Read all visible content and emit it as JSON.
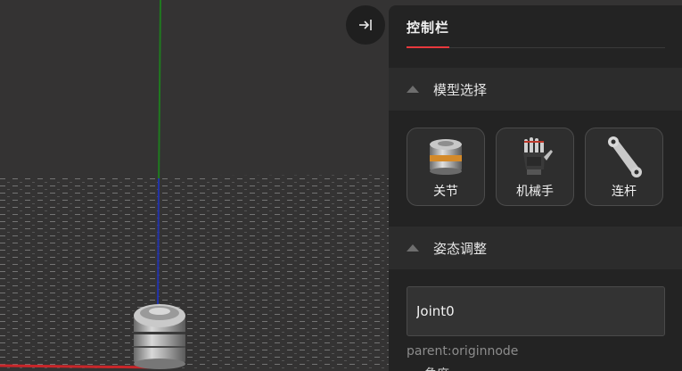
{
  "panel": {
    "title": "控制栏"
  },
  "sections": {
    "model": {
      "label": "模型选择",
      "cards": [
        {
          "label": "关节",
          "icon": "joint-icon"
        },
        {
          "label": "机械手",
          "icon": "robot-hand-icon"
        },
        {
          "label": "连杆",
          "icon": "link-icon"
        }
      ]
    },
    "pose": {
      "label": "姿态调整",
      "node_name": "Joint0",
      "parent": "parent:originnode",
      "next_row": "角度"
    }
  },
  "colors": {
    "accent": "#e8383d",
    "axis_x": "#c8262a",
    "axis_y": "#1f7a1f",
    "axis_z": "#2233aa",
    "panel_bg": "#232323",
    "viewport_bg": "#343333"
  },
  "icons": {
    "collapse": "collapse-right-icon"
  }
}
